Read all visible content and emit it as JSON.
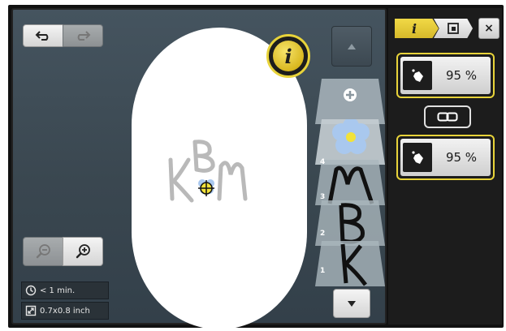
{
  "toolbar": {
    "undo_icon": "undo-arrow-icon",
    "redo_icon": "redo-arrow-icon",
    "zoom_out_icon": "zoom-out-icon",
    "zoom_in_icon": "zoom-in-icon"
  },
  "info_button": {
    "label": "i"
  },
  "design": {
    "monogram_text": "KBM",
    "flower_color": "#a9c8ee",
    "flower_center_color": "#f2e23a"
  },
  "status": {
    "time": "< 1 min.",
    "size": "0.7x0.8 inch"
  },
  "layers": {
    "add_icon": "plus-icon",
    "items": [
      {
        "number": "4",
        "content": "flower"
      },
      {
        "number": "3",
        "content": "letter-M"
      },
      {
        "number": "2",
        "content": "letter-B"
      },
      {
        "number": "1",
        "content": "letter-K"
      }
    ],
    "scroll_up_icon": "arrow-up-icon",
    "scroll_down_icon": "arrow-down-icon"
  },
  "right_panel": {
    "tab_info_label": "i",
    "tab_view_icon": "view-icon",
    "close_label": "×",
    "scale_width_value": "95 %",
    "scale_height_value": "95 %",
    "link_icon": "link-chain-icon"
  },
  "colors": {
    "accent": "#e8d33a",
    "panel_bg": "#3c4851",
    "hoop_bg": "#ffffff"
  }
}
